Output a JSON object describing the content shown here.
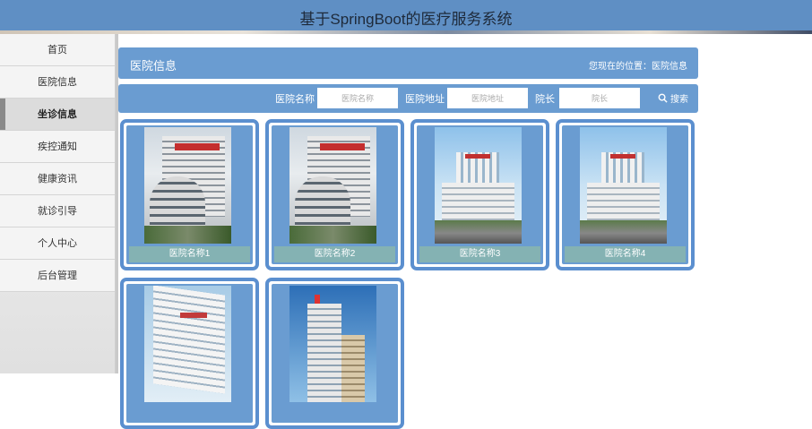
{
  "app": {
    "title": "基于SpringBoot的医疗服务系统"
  },
  "sidebar": {
    "items": [
      {
        "label": "首页"
      },
      {
        "label": "医院信息"
      },
      {
        "label": "坐诊信息",
        "active": true
      },
      {
        "label": "疾控通知"
      },
      {
        "label": "健康资讯"
      },
      {
        "label": "就诊引导"
      },
      {
        "label": "个人中心"
      },
      {
        "label": "后台管理"
      }
    ]
  },
  "page": {
    "title": "医院信息",
    "location": "您现在的位置：医院信息"
  },
  "search": {
    "name_label": "医院名称",
    "name_placeholder": "医院名称",
    "address_label": "医院地址",
    "address_placeholder": "医院地址",
    "director_label": "院长",
    "director_placeholder": "院长",
    "button_label": "搜索",
    "button_icon": "search-icon"
  },
  "cards": [
    {
      "name": "医院名称1"
    },
    {
      "name": "医院名称2"
    },
    {
      "name": "医院名称3"
    },
    {
      "name": "医院名称4"
    }
  ],
  "colors": {
    "header": "#5f8fc4",
    "panel": "#6a9cd1",
    "card_border": "#5b8fcf",
    "caption": "#84b2b3"
  }
}
